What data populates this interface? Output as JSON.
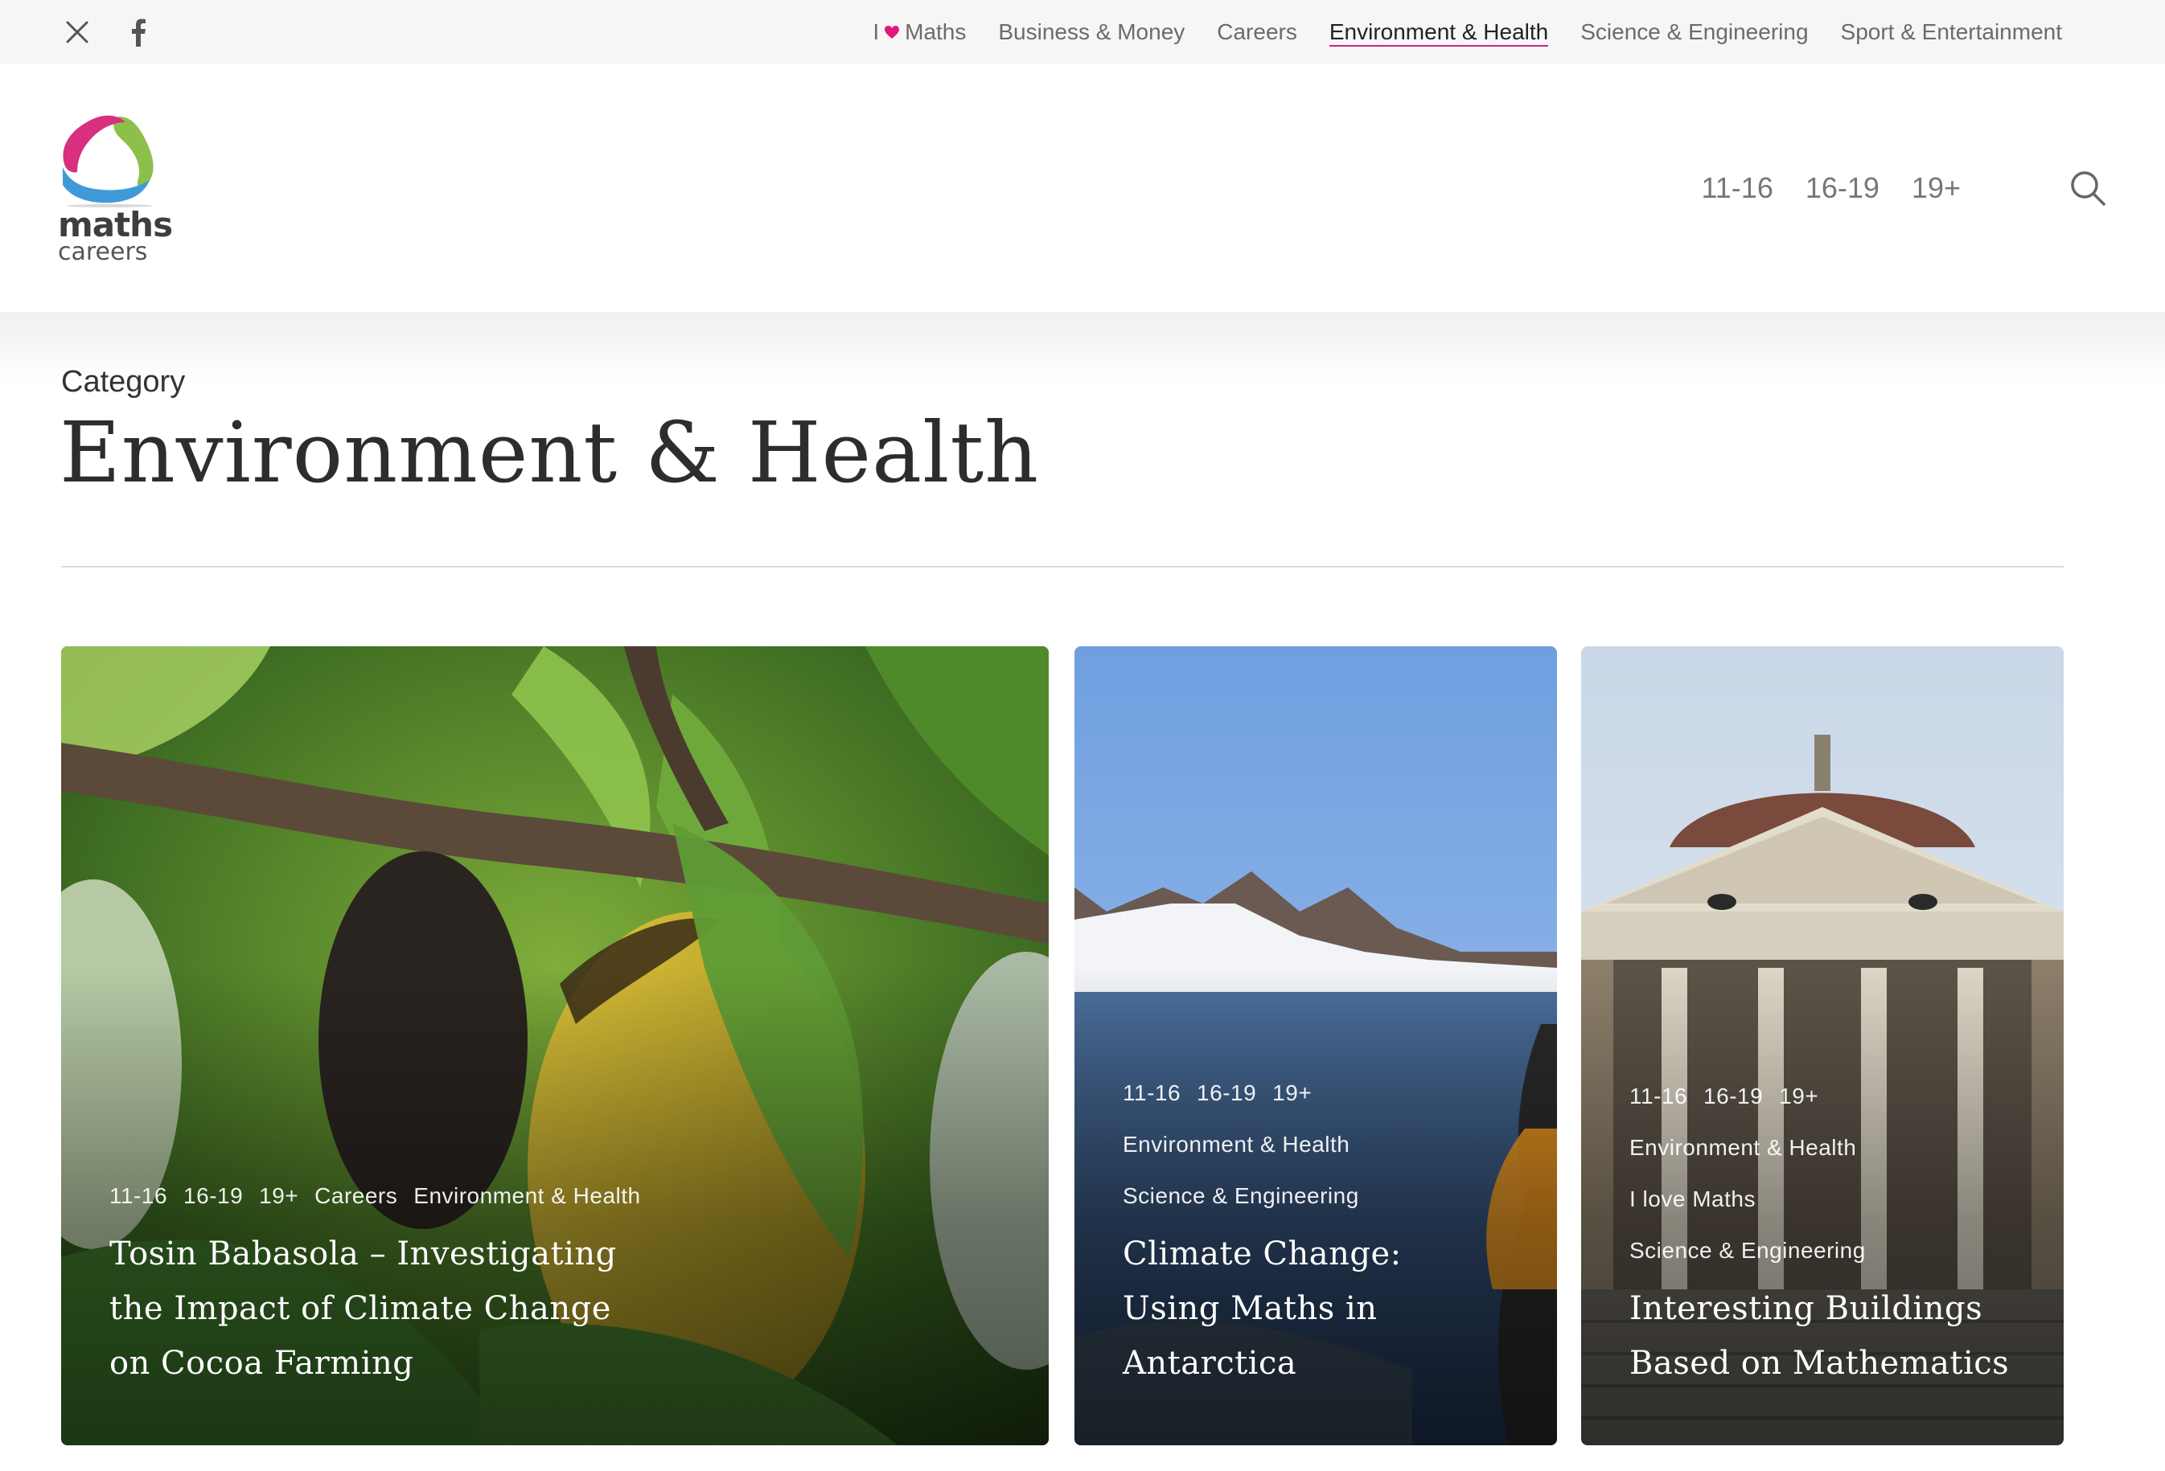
{
  "topbar": {
    "social": [
      {
        "name": "x-icon"
      },
      {
        "name": "facebook-icon"
      }
    ],
    "nav": [
      {
        "prefix": "I",
        "label": "Maths",
        "icon": "heart-icon"
      },
      {
        "label": "Business & Money"
      },
      {
        "label": "Careers"
      },
      {
        "label": "Environment & Health",
        "active": true
      },
      {
        "label": "Science & Engineering"
      },
      {
        "label": "Sport & Entertainment"
      }
    ],
    "heart_color": "#e0197d"
  },
  "header": {
    "logo": {
      "line1": "maths",
      "line2": "careers"
    },
    "age_nav": [
      "11-16",
      "16-19",
      "19+"
    ]
  },
  "category": {
    "label": "Category",
    "title": "Environment & Health"
  },
  "cards": [
    {
      "tags": [
        "11-16",
        "16-19",
        "19+",
        "Careers",
        "Environment & Health"
      ],
      "title": "Tosin Babasola – Investigating the Impact of Climate Change on Cocoa Farming"
    },
    {
      "tags": [
        "11-16",
        "16-19",
        "19+",
        "Environment & Health",
        "Science & Engineering"
      ],
      "title": "Climate Change: Using Maths in Antarctica"
    },
    {
      "tags": [
        "11-16",
        "16-19",
        "19+",
        "Environment & Health",
        "I love Maths",
        "Science & Engineering"
      ],
      "title": "Interesting Buildings Based on Mathematics"
    }
  ],
  "colors": {
    "accent": "#c6297f",
    "logo_pink": "#d6307f",
    "logo_green": "#8cc04b",
    "logo_blue": "#3f9ad8"
  }
}
